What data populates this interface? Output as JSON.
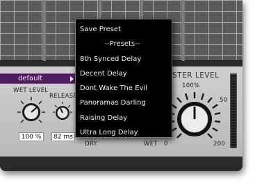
{
  "preset_selector": {
    "current": "default"
  },
  "labels": {
    "wet_level": "WET LEVEL",
    "release": "RELEASE",
    "master_level": "STER LEVEL",
    "dry": "DRY",
    "wet": "WET"
  },
  "values": {
    "wet_level": "100 %",
    "release": "82 ms"
  },
  "master_scale": {
    "top": "100%",
    "mid": "50",
    "low": "0",
    "high": "200"
  },
  "menu": {
    "items": [
      "Save Preset",
      "--Presets--",
      "8th Synced Delay",
      "Decent Delay",
      "Dont Wake The Evil",
      "Panoramas Darling",
      "Raising Delay",
      "Ultra Long Delay"
    ]
  },
  "colors": {
    "preset_bar": "#4d1d5e",
    "menu_bg": "#000000",
    "menu_text": "#f2f2f2",
    "panel": "#c7c7c7"
  }
}
